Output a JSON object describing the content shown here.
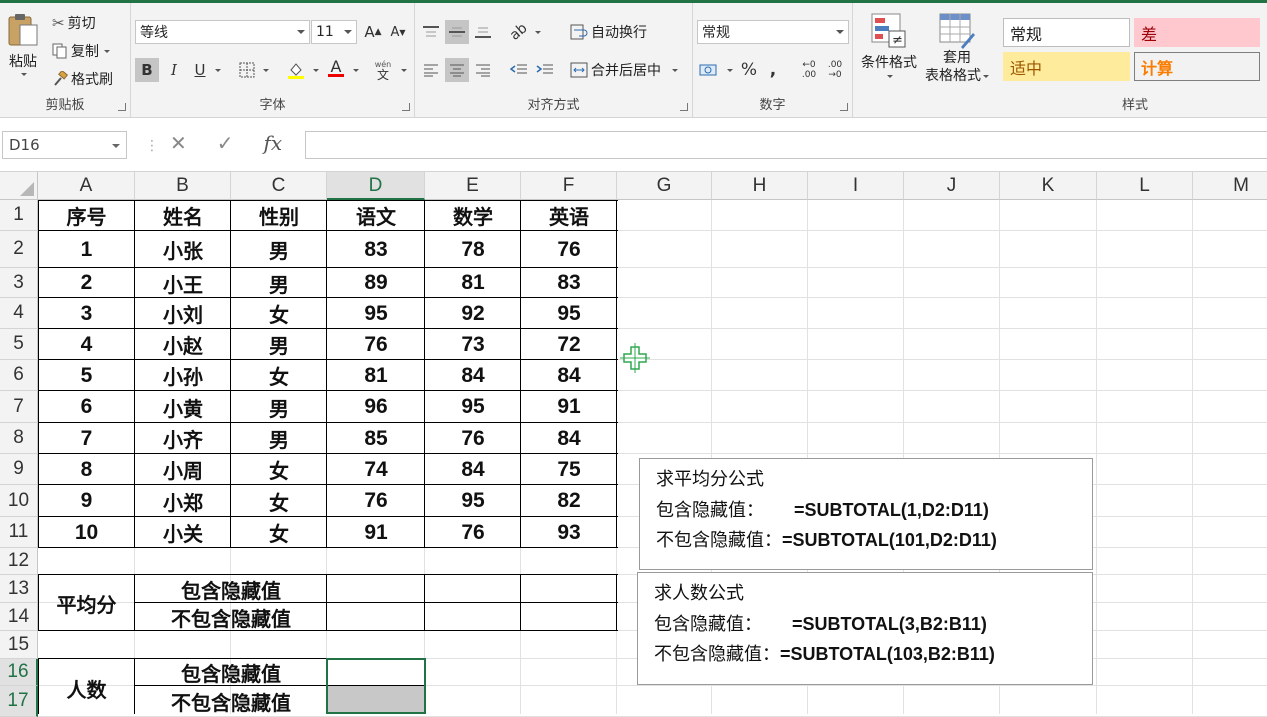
{
  "ribbon": {
    "clipboard": {
      "label": "剪贴板",
      "paste": "粘贴",
      "cut": "剪切",
      "copy": "复制",
      "format_painter": "格式刷"
    },
    "font": {
      "label": "字体",
      "font_name": "等线",
      "font_size": "11",
      "grow": "A",
      "shrink": "A",
      "bold": "B",
      "italic": "I",
      "underline": "U",
      "phonetic": "文"
    },
    "alignment": {
      "label": "对齐方式",
      "wrap": "自动换行",
      "merge": "合并后居中"
    },
    "number": {
      "label": "数字",
      "format": "常规",
      "percent": "%",
      "comma": ",",
      "inc_decimal": ".00",
      "dec_decimal": ".00"
    },
    "styles": {
      "label": "样式",
      "conditional": "条件格式",
      "table_format": "套用\n表格格式",
      "table_format_line1": "套用",
      "table_format_line2": "表格格式",
      "normal": "常规",
      "bad": "差",
      "neutral": "适中",
      "calc": "计算"
    }
  },
  "formula_bar": {
    "name_box": "D16",
    "cancel": "✕",
    "enter": "✓",
    "fx": "fx",
    "formula": ""
  },
  "columns": [
    "A",
    "B",
    "C",
    "D",
    "E",
    "F",
    "G",
    "H",
    "I",
    "J",
    "K",
    "L",
    "M"
  ],
  "rows": [
    "1",
    "2",
    "3",
    "4",
    "5",
    "6",
    "7",
    "8",
    "9",
    "10",
    "11",
    "12",
    "13",
    "14",
    "15",
    "16",
    "17"
  ],
  "selected_cell": "D16",
  "table": {
    "headers": [
      "序号",
      "姓名",
      "性别",
      "语文",
      "数学",
      "英语"
    ],
    "rows": [
      [
        "1",
        "小张",
        "男",
        "83",
        "78",
        "76"
      ],
      [
        "2",
        "小王",
        "男",
        "89",
        "81",
        "83"
      ],
      [
        "3",
        "小刘",
        "女",
        "95",
        "92",
        "95"
      ],
      [
        "4",
        "小赵",
        "男",
        "76",
        "73",
        "72"
      ],
      [
        "5",
        "小孙",
        "女",
        "81",
        "84",
        "84"
      ],
      [
        "6",
        "小黄",
        "男",
        "96",
        "95",
        "91"
      ],
      [
        "7",
        "小齐",
        "男",
        "85",
        "76",
        "84"
      ],
      [
        "8",
        "小周",
        "女",
        "74",
        "84",
        "75"
      ],
      [
        "9",
        "小郑",
        "女",
        "76",
        "95",
        "82"
      ],
      [
        "10",
        "小关",
        "女",
        "91",
        "76",
        "93"
      ]
    ]
  },
  "summary": {
    "avg_label": "平均分",
    "count_label": "人数",
    "include_hidden": "包含隐藏值",
    "exclude_hidden": "不包含隐藏值"
  },
  "note_avg": {
    "title": "求平均分公式",
    "line1_label": "包含隐藏值：",
    "line1_formula": "=SUBTOTAL(1,D2:D11)",
    "line2_label": "不包含隐藏值：",
    "line2_formula": "=SUBTOTAL(101,D2:D11)"
  },
  "note_count": {
    "title": "求人数公式",
    "line1_label": "包含隐藏值：",
    "line1_formula": "=SUBTOTAL(3,B2:B11)",
    "line2_label": "不包含隐藏值：",
    "line2_formula": "=SUBTOTAL(103,B2:B11)"
  },
  "colors": {
    "accent": "#217346",
    "bad_bg": "#ffc7ce",
    "bad_fg": "#9c0006",
    "neutral_bg": "#ffeb9c",
    "neutral_fg": "#9c5700",
    "calc_bg": "#f2f2f2",
    "calc_fg": "#fa7d00"
  }
}
